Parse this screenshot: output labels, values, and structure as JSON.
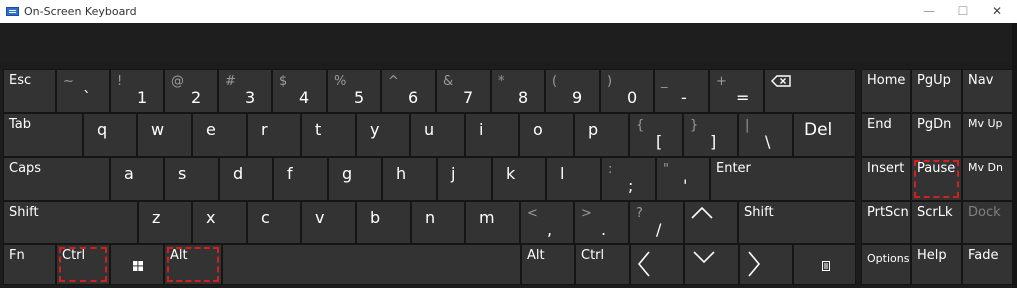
{
  "window": {
    "title": "On-Screen Keyboard",
    "controls": [
      "—",
      "☐",
      "✕"
    ]
  },
  "colors": {
    "key_bg": "#333333",
    "key_border": "#151515",
    "highlight": "#d21f1f",
    "background": "#1c1c1c"
  },
  "rows": {
    "row1": [
      {
        "name": "esc",
        "label": "Esc"
      },
      {
        "name": "tilde",
        "shift": "~",
        "main": "`"
      },
      {
        "name": "1",
        "shift": "!",
        "main": "1"
      },
      {
        "name": "2",
        "shift": "@",
        "main": "2"
      },
      {
        "name": "3",
        "shift": "#",
        "main": "3"
      },
      {
        "name": "4",
        "shift": "$",
        "main": "4"
      },
      {
        "name": "5",
        "shift": "%",
        "main": "5"
      },
      {
        "name": "6",
        "shift": "^",
        "main": "6"
      },
      {
        "name": "7",
        "shift": "&",
        "main": "7"
      },
      {
        "name": "8",
        "shift": "*",
        "main": "8"
      },
      {
        "name": "9",
        "shift": "(",
        "main": "9"
      },
      {
        "name": "0",
        "shift": ")",
        "main": "0"
      },
      {
        "name": "minus",
        "shift": "_",
        "main": "-"
      },
      {
        "name": "equals",
        "shift": "+",
        "main": "="
      },
      {
        "name": "backspace",
        "icon": "backspace-icon"
      }
    ],
    "row2": [
      {
        "name": "tab",
        "label": "Tab"
      },
      {
        "name": "q",
        "label": "q"
      },
      {
        "name": "w",
        "label": "w"
      },
      {
        "name": "e",
        "label": "e"
      },
      {
        "name": "r",
        "label": "r"
      },
      {
        "name": "t",
        "label": "t"
      },
      {
        "name": "y",
        "label": "y"
      },
      {
        "name": "u",
        "label": "u"
      },
      {
        "name": "i",
        "label": "i"
      },
      {
        "name": "o",
        "label": "o"
      },
      {
        "name": "p",
        "label": "p"
      },
      {
        "name": "lbracket",
        "shift": "{",
        "main": "["
      },
      {
        "name": "rbracket",
        "shift": "}",
        "main": "]"
      },
      {
        "name": "backslash",
        "shift": "|",
        "main": "\\"
      },
      {
        "name": "del",
        "label": "Del"
      }
    ],
    "row3": [
      {
        "name": "caps",
        "label": "Caps"
      },
      {
        "name": "a",
        "label": "a"
      },
      {
        "name": "s",
        "label": "s"
      },
      {
        "name": "d",
        "label": "d"
      },
      {
        "name": "f",
        "label": "f"
      },
      {
        "name": "g",
        "label": "g"
      },
      {
        "name": "h",
        "label": "h"
      },
      {
        "name": "j",
        "label": "j"
      },
      {
        "name": "k",
        "label": "k"
      },
      {
        "name": "l",
        "label": "l"
      },
      {
        "name": "semicolon",
        "shift": ":",
        "main": ";"
      },
      {
        "name": "quote",
        "shift": "\"",
        "main": "'"
      },
      {
        "name": "enter",
        "label": "Enter"
      }
    ],
    "row4": [
      {
        "name": "shift-left",
        "label": "Shift"
      },
      {
        "name": "z",
        "label": "z"
      },
      {
        "name": "x",
        "label": "x"
      },
      {
        "name": "c",
        "label": "c"
      },
      {
        "name": "v",
        "label": "v"
      },
      {
        "name": "b",
        "label": "b"
      },
      {
        "name": "n",
        "label": "n"
      },
      {
        "name": "m",
        "label": "m"
      },
      {
        "name": "comma",
        "shift": "<",
        "main": ","
      },
      {
        "name": "period",
        "shift": ">",
        "main": "."
      },
      {
        "name": "slash",
        "shift": "?",
        "main": "/"
      },
      {
        "name": "up",
        "icon": "arrow-up-icon"
      },
      {
        "name": "shift-right",
        "label": "Shift"
      }
    ],
    "row5": [
      {
        "name": "fn",
        "label": "Fn"
      },
      {
        "name": "ctrl-left",
        "label": "Ctrl"
      },
      {
        "name": "win",
        "icon": "windows-icon"
      },
      {
        "name": "alt-left",
        "label": "Alt"
      },
      {
        "name": "space",
        "label": ""
      },
      {
        "name": "alt-right",
        "label": "Alt"
      },
      {
        "name": "ctrl-right",
        "label": "Ctrl"
      },
      {
        "name": "left",
        "icon": "arrow-left-icon"
      },
      {
        "name": "down",
        "icon": "arrow-down-icon"
      },
      {
        "name": "right",
        "icon": "arrow-right-icon"
      },
      {
        "name": "menu",
        "icon": "menu-icon"
      }
    ]
  },
  "nav": {
    "home": "Home",
    "pgup": "PgUp",
    "nav": "Nav",
    "end": "End",
    "pgdn": "PgDn",
    "mvup": "Mv Up",
    "insert": "Insert",
    "pause": "Pause",
    "mvdn": "Mv Dn",
    "prtscn": "PrtScn",
    "scrlk": "ScrLk",
    "dock": "Dock",
    "options": "Options",
    "help": "Help",
    "fade": "Fade"
  }
}
